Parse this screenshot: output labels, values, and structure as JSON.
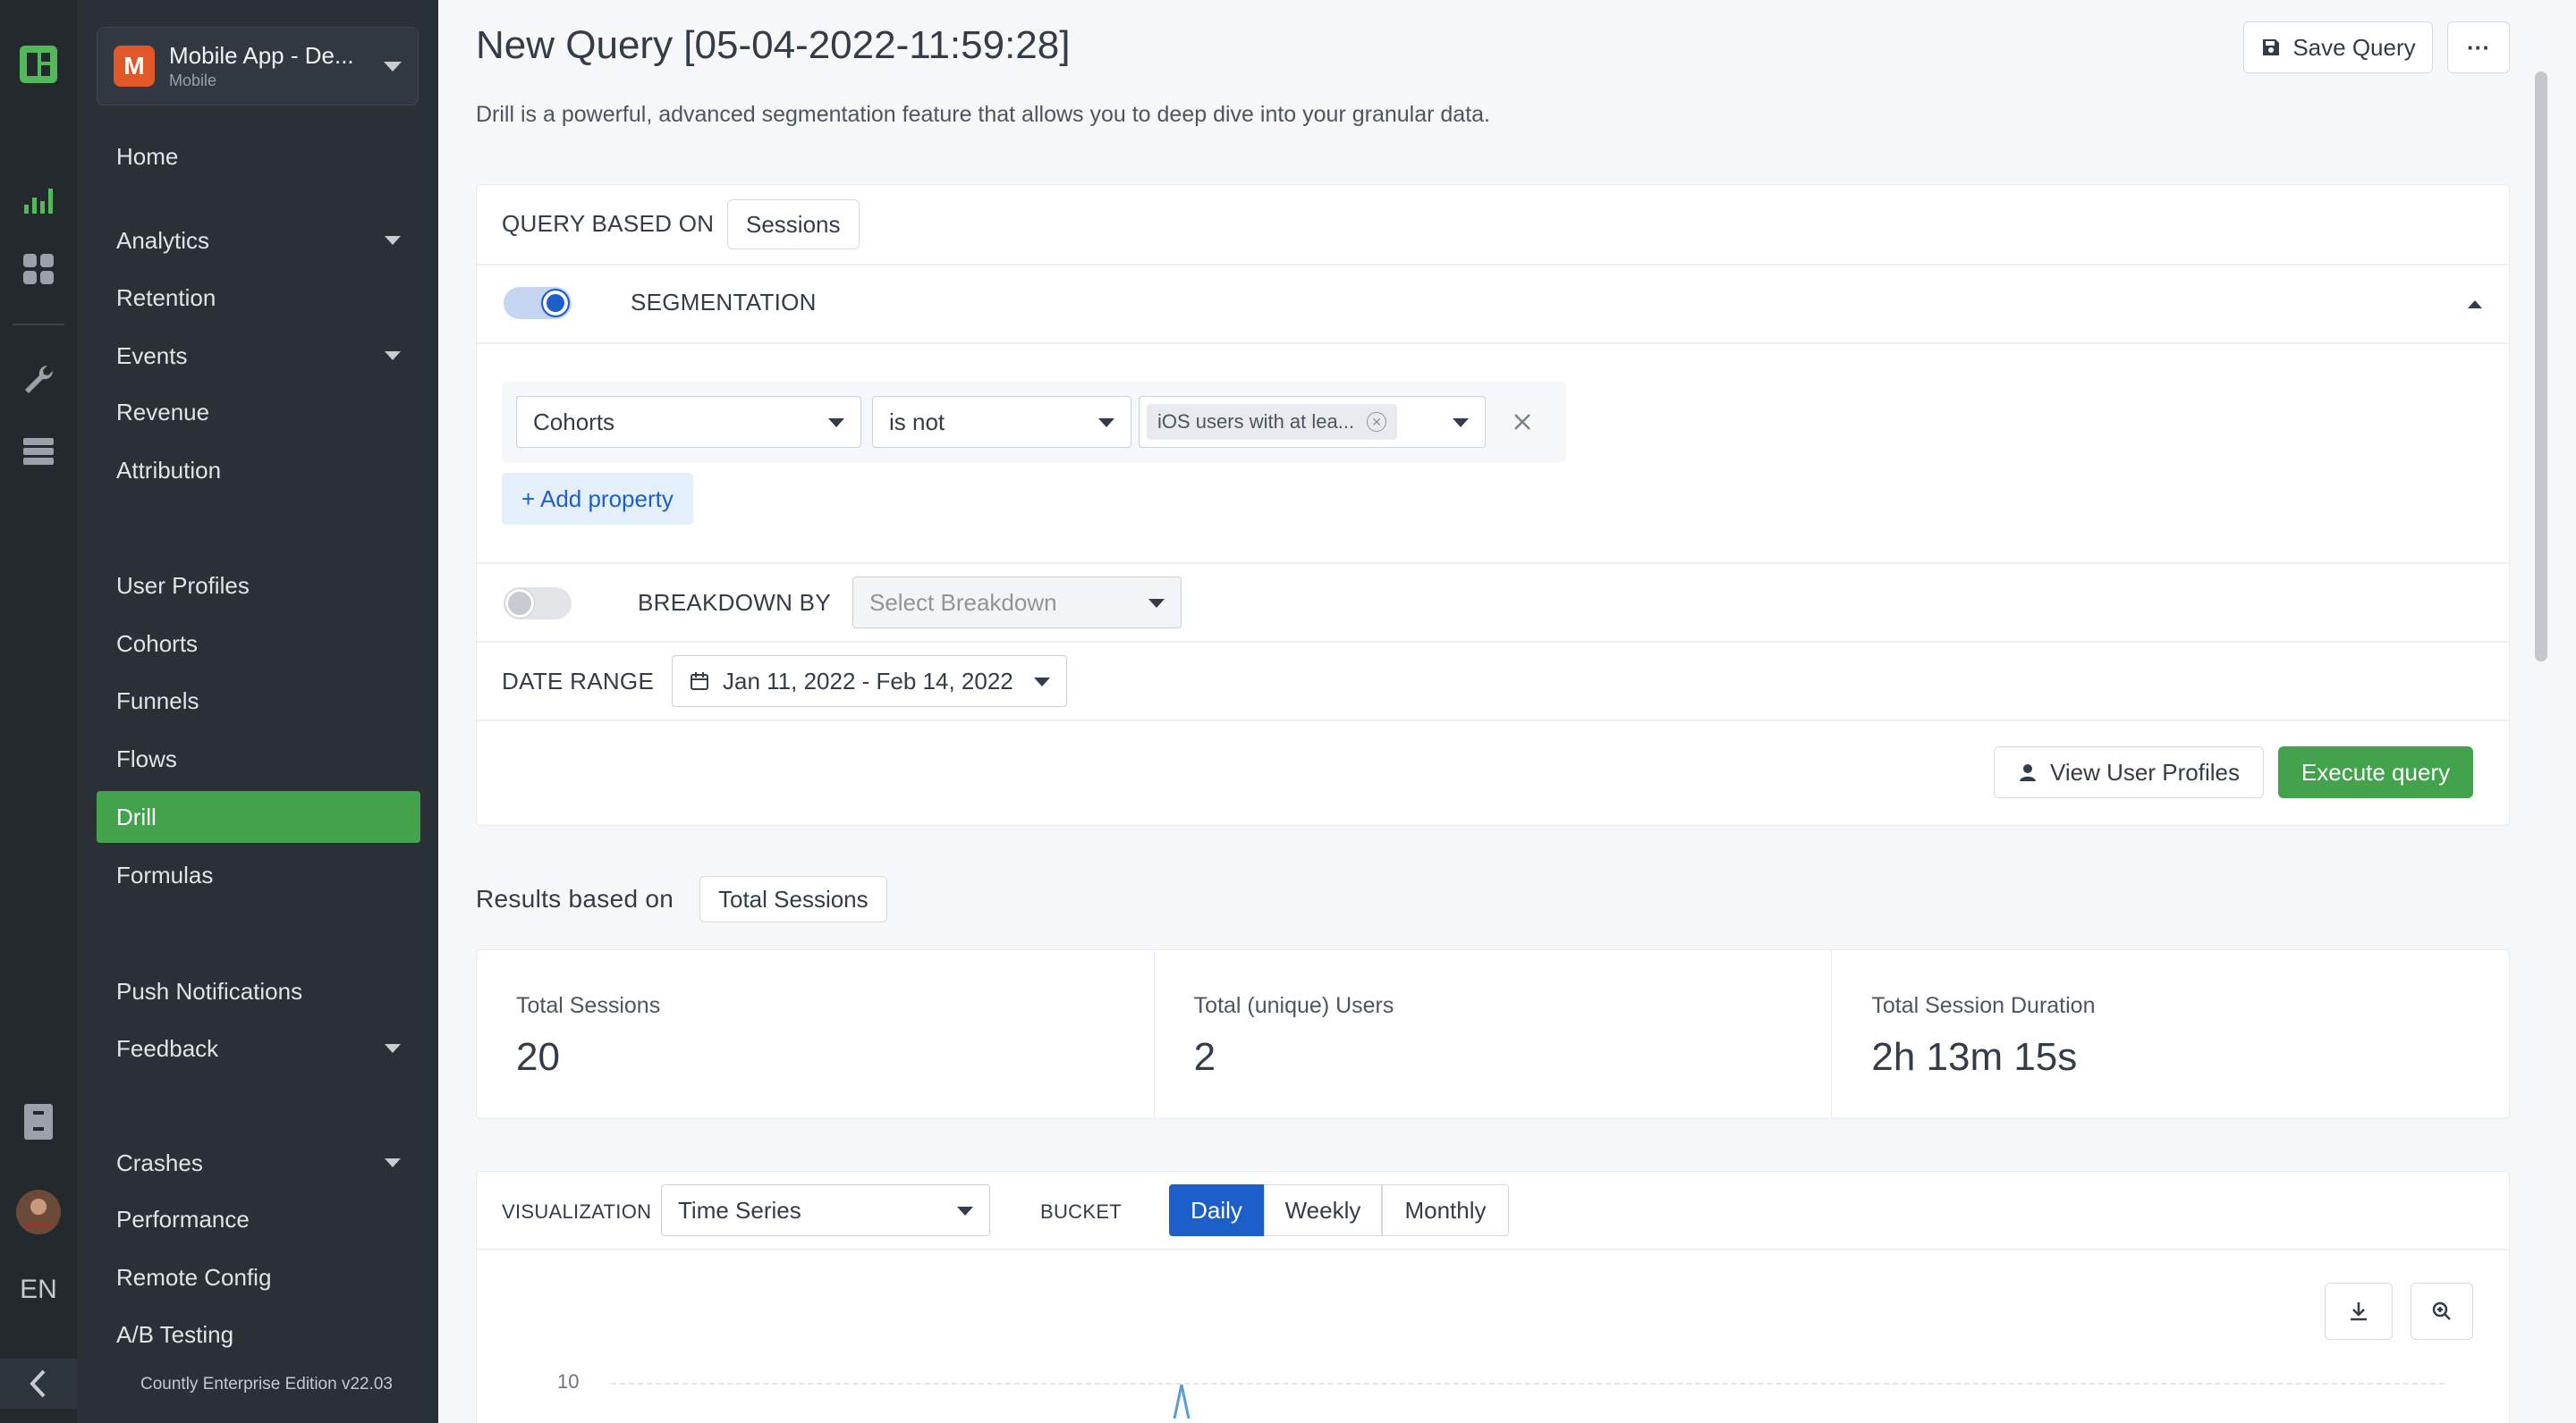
{
  "rail": {
    "items": [
      "countly-logo-icon",
      "analytics-bars-icon",
      "dashboard-grid-icon",
      "wrench-icon",
      "database-icon",
      "clipboard-icon",
      "user-avatar"
    ],
    "language": "EN"
  },
  "sidebar": {
    "app": {
      "initial": "M",
      "name": "Mobile App - De...",
      "type": "Mobile"
    },
    "items": [
      {
        "label": "Home"
      },
      {
        "label": "Analytics"
      },
      {
        "label": "Retention"
      },
      {
        "label": "Events"
      },
      {
        "label": "Revenue"
      },
      {
        "label": "Attribution"
      },
      {
        "label": "User Profiles"
      },
      {
        "label": "Cohorts"
      },
      {
        "label": "Funnels"
      },
      {
        "label": "Flows"
      },
      {
        "label": "Drill"
      },
      {
        "label": "Formulas"
      },
      {
        "label": "Push Notifications"
      },
      {
        "label": "Feedback"
      },
      {
        "label": "Crashes"
      },
      {
        "label": "Performance"
      },
      {
        "label": "Remote Config"
      },
      {
        "label": "A/B Testing"
      }
    ],
    "footer": "Countly Enterprise Edition v22.03"
  },
  "header": {
    "title": "New Query [05-04-2022-11:59:28]",
    "description": "Drill is a powerful, advanced segmentation feature that allows you to deep dive into your granular data.",
    "save_label": "Save Query",
    "more_label": "···"
  },
  "query": {
    "based_on_label": "QUERY BASED ON",
    "based_on_value": "Sessions",
    "segmentation_label": "SEGMENTATION",
    "filter": {
      "property": "Cohorts",
      "operator": "is not",
      "value_chip": "iOS users with at lea..."
    },
    "add_property": "+ Add property",
    "breakdown_label": "BREAKDOWN BY",
    "breakdown_placeholder": "Select Breakdown",
    "date_range_label": "DATE RANGE",
    "date_range_value": "Jan 11, 2022 - Feb 14, 2022",
    "view_profiles": "View User Profiles",
    "execute": "Execute query"
  },
  "results": {
    "label": "Results based on",
    "metric": "Total Sessions",
    "stats": [
      {
        "label": "Total Sessions",
        "value": "20"
      },
      {
        "label": "Total (unique) Users",
        "value": "2"
      },
      {
        "label": "Total Session Duration",
        "value": "2h 13m 15s"
      }
    ]
  },
  "visualization": {
    "label": "VISUALIZATION",
    "type": "Time Series",
    "bucket_label": "BUCKET",
    "buckets": [
      "Daily",
      "Weekly",
      "Monthly"
    ],
    "active_bucket": "Daily",
    "y_tick": "10"
  },
  "colors": {
    "accent_green": "#43a34c",
    "accent_blue": "#1d5fc9",
    "sidebar_bg": "#2a3036",
    "rail_bg": "#24292e"
  }
}
